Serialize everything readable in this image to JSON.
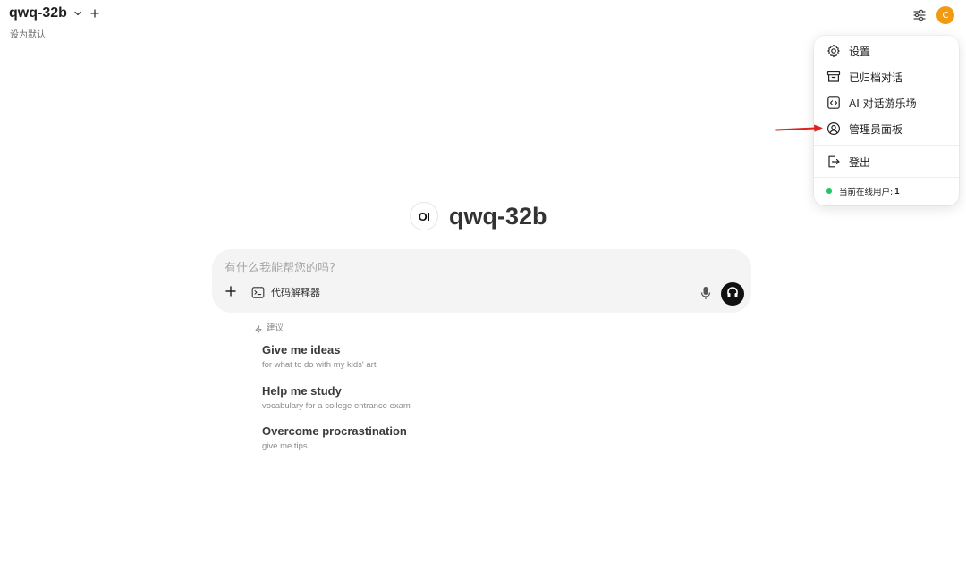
{
  "header": {
    "model_name": "qwq-32b",
    "set_default_label": "设为默认",
    "avatar_initial": "C"
  },
  "menu": {
    "items": [
      {
        "label": "设置",
        "icon": "gear-icon"
      },
      {
        "label": "已归档对话",
        "icon": "archive-icon"
      },
      {
        "label": "AI 对话游乐场",
        "icon": "code-icon"
      },
      {
        "label": "管理员面板",
        "icon": "user-circle-icon"
      },
      {
        "label": "登出",
        "icon": "logout-icon"
      }
    ],
    "online_label": "当前在线用户:",
    "online_count": "1",
    "online_color": "#22c55e"
  },
  "hero": {
    "logo_text": "OI",
    "title": "qwq-32b"
  },
  "prompt": {
    "placeholder": "有什么我能帮您的吗?",
    "code_interpreter_label": "代码解释器"
  },
  "suggestions": {
    "header": "建议",
    "items": [
      {
        "title": "Give me ideas",
        "subtitle": "for what to do with my kids' art"
      },
      {
        "title": "Help me study",
        "subtitle": "vocabulary for a college entrance exam"
      },
      {
        "title": "Overcome procrastination",
        "subtitle": "give me tips"
      }
    ]
  },
  "colors": {
    "avatar": "#f29a12",
    "annotation_arrow": "#e02020"
  }
}
